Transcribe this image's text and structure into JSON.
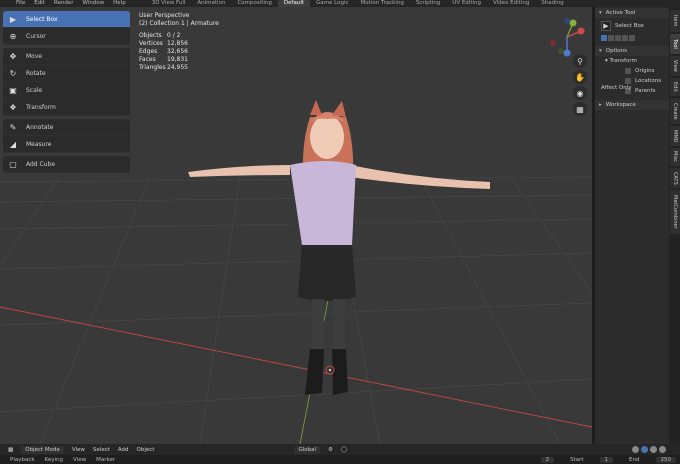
{
  "topbar": {
    "menu": [
      "File",
      "Edit",
      "Render",
      "Window",
      "Help"
    ],
    "workspaces": [
      "3D View Full",
      "Animation",
      "Compositing",
      "Default",
      "Game Logic",
      "Motion Tracking",
      "Scripting",
      "UV Editing",
      "Video Editing",
      "Shading"
    ],
    "active_workspace": "Default"
  },
  "toolbar": {
    "tools": [
      {
        "label": "Select Box",
        "icon": "select-box-icon",
        "active": true
      },
      {
        "label": "Cursor",
        "icon": "cursor-icon"
      },
      {
        "label": "Move",
        "icon": "move-icon"
      },
      {
        "label": "Rotate",
        "icon": "rotate-icon"
      },
      {
        "label": "Scale",
        "icon": "scale-icon"
      },
      {
        "label": "Transform",
        "icon": "transform-icon"
      },
      {
        "label": "Annotate",
        "icon": "annotate-icon"
      },
      {
        "label": "Measure",
        "icon": "measure-icon"
      },
      {
        "label": "Add Cube",
        "icon": "add-cube-icon"
      }
    ]
  },
  "overlay": {
    "view_name": "User Perspective",
    "collection": "(2) Collection 1 | Armature",
    "stats": [
      {
        "label": "Objects",
        "value": "0 / 2"
      },
      {
        "label": "Vertices",
        "value": "12,856"
      },
      {
        "label": "Edges",
        "value": "32,656"
      },
      {
        "label": "Faces",
        "value": "19,831"
      },
      {
        "label": "Triangles",
        "value": "24,955"
      }
    ]
  },
  "npanel": {
    "active_tool_header": "Active Tool",
    "active_tool_name": "Select Box",
    "options_header": "Options",
    "transform_header": "Transform",
    "affect_label": "Affect Only",
    "affect_options": [
      "Origins",
      "Locations",
      "Parents"
    ],
    "workspace_header": "Workspace"
  },
  "vtabs": [
    "Item",
    "Tool",
    "View",
    "Edit",
    "Create",
    "MMD",
    "Misc",
    "CATS",
    "MatCombiner"
  ],
  "active_vtab": "Tool",
  "bottombar": {
    "mode": "Object Mode",
    "menus": [
      "View",
      "Select",
      "Add",
      "Object"
    ],
    "orientation": "Global"
  },
  "timeline": {
    "menus": [
      "Playback",
      "Keying",
      "View",
      "Marker"
    ],
    "current_frame": "2",
    "start_label": "Start",
    "start_value": "1",
    "end_label": "End",
    "end_value": "250"
  },
  "colors": {
    "accent": "#4772b3",
    "viewport_bg": "#393939",
    "x_axis": "#c14848",
    "y_axis": "#7b9a3b"
  }
}
